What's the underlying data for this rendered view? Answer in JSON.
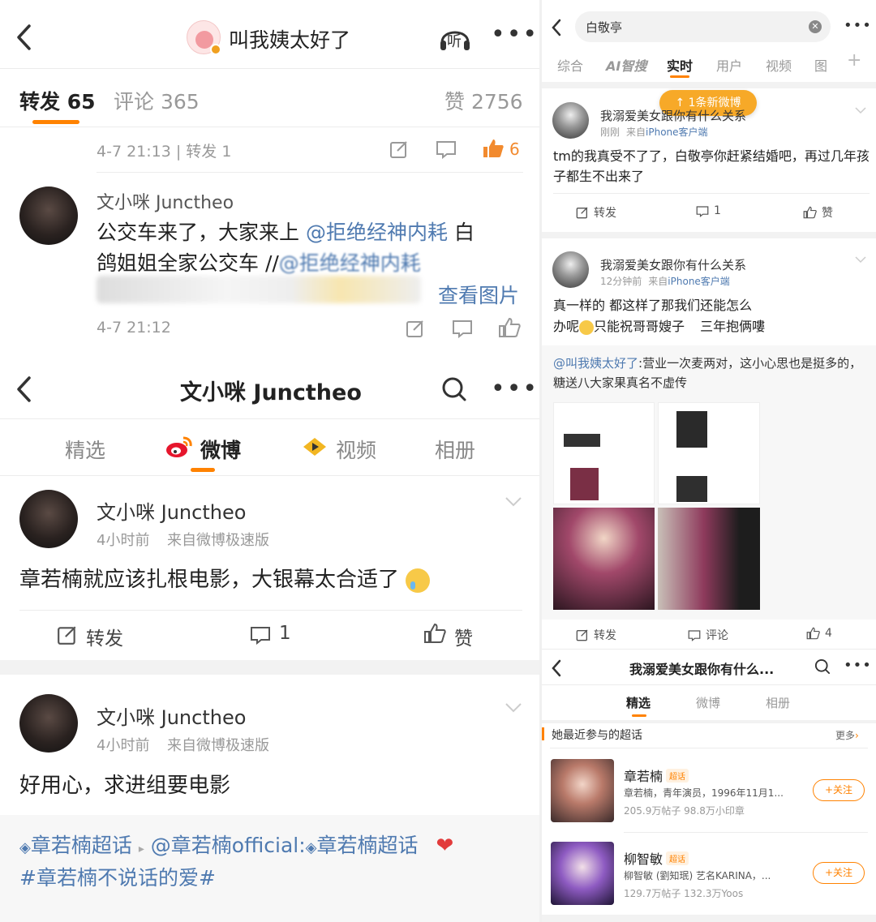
{
  "left_top": {
    "title": "叫我姨太好了",
    "listen_label": "听",
    "tabs": {
      "repost": "转发 65",
      "comment": "评论 365",
      "like": "赞 2756"
    },
    "item1": {
      "meta": "4-7 21:13 | 转发 1",
      "likes": "6"
    },
    "item2": {
      "name": "文小咪 Junctheo",
      "text_a": "公交车来了，大家来上",
      "mention_a": "@拒绝经神内耗",
      "text_b": "白",
      "text_c": "鸽姐姐全家公交车 //",
      "mention_b": "@拒绝经神内耗",
      "view_image": "查看图片",
      "time": "4-7 21:12"
    }
  },
  "left_profile": {
    "title": "文小咪 Junctheo",
    "tabs": [
      "精选",
      "微博",
      "视频",
      "相册"
    ],
    "post1": {
      "name": "文小咪 Junctheo",
      "time": "4小时前",
      "source": "来自微博极速版",
      "content": "章若楠就应该扎根电影，大银幕太合适了",
      "repost": "转发",
      "comment": "1",
      "like": "赞"
    },
    "post2": {
      "name": "文小咪 Junctheo",
      "time": "4小时前",
      "source": "来自微博极速版",
      "content": "好用心，求进组要电影",
      "tag1": "章若楠超话",
      "mention": "@章若楠official:",
      "tag2": "章若楠超话",
      "tag3": "#章若楠不说话的爱#"
    }
  },
  "right_search": {
    "query": "白敬亭",
    "tabs": [
      "综合",
      "AI智搜",
      "实时",
      "用户",
      "视频",
      "图"
    ],
    "new_badge": "↑ 1条新微博",
    "post1": {
      "name": "我溺爱美女跟你有什么关系",
      "time": "刚刚",
      "source_prefix": "来自",
      "source": "iPhone客户端",
      "content": "tm的我真受不了了，白敬亭你赶紧结婚吧，再过几年孩子都生不出来了",
      "repost": "转发",
      "comment": "1",
      "like": "赞"
    },
    "post2": {
      "name": "我溺爱美女跟你有什么关系",
      "time": "12分钟前",
      "source_prefix": "来自",
      "source": "iPhone客户端",
      "content_a": "真一样的 都这样了那我们还能怎么",
      "content_b": "办呢",
      "content_c": "只能祝哥哥嫂子",
      "content_d": "三年抱俩",
      "content_e": "三年抱俩嘍",
      "repost_mention": "@叫我姨太好了",
      "repost_text": ":营业一次麦两对，这小心思也是挺多的，糖送八大家果真名不虚传",
      "repost": "转发",
      "comment": "评论",
      "like": "4"
    }
  },
  "right_profile": {
    "title": "我溺爱美女跟你有什么...",
    "tabs": [
      "精选",
      "微博",
      "相册"
    ],
    "section": "她最近参与的超话",
    "more": "更多",
    "topics": [
      {
        "name": "章若楠",
        "tag": "超话",
        "desc": "章若楠，青年演员，1996年11月1...",
        "stats": "205.9万帖子 98.8万小印章",
        "follow": "+关注"
      },
      {
        "name": "柳智敏",
        "tag": "超话",
        "desc": "柳智敏 (劉知珉) 艺名KARINA，...",
        "stats": "129.7万帖子 132.3万Yoos",
        "follow": "+关注"
      }
    ]
  }
}
